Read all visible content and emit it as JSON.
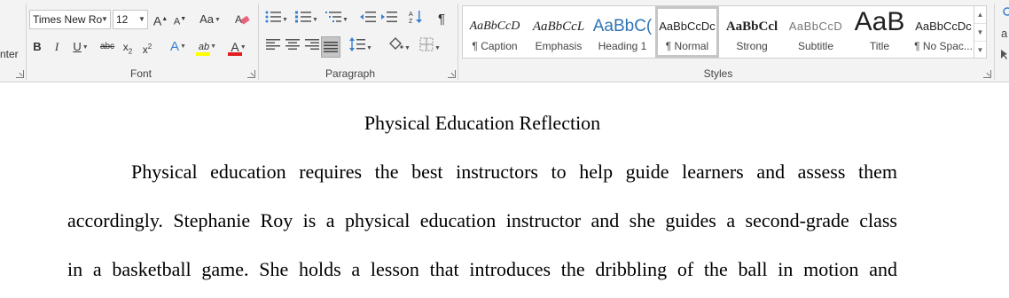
{
  "ribbon": {
    "clipboard": {
      "label_partial": "nter"
    },
    "font": {
      "group_label": "Font",
      "font_name": "Times New Ro",
      "font_size": "12",
      "grow_label": "A",
      "shrink_label": "A",
      "change_case_label": "Aa",
      "bold_label": "B",
      "italic_label": "I",
      "underline_label": "U",
      "strike_label": "abc",
      "subscript_label": "x",
      "subscript_sub": "2",
      "superscript_label": "x",
      "superscript_sup": "2",
      "text_effects_label": "A",
      "highlight_label": "ab",
      "font_color_label": "A",
      "highlight_color": "#ffff00",
      "font_color": "#e01f1f"
    },
    "paragraph": {
      "group_label": "Paragraph",
      "show_marks_label": "¶"
    },
    "styles": {
      "group_label": "Styles",
      "items": [
        {
          "sample": "AaBbCcD",
          "name": "¶ Caption"
        },
        {
          "sample": "AaBbCcL",
          "name": "Emphasis"
        },
        {
          "sample": "AaBbC(",
          "name": "Heading 1"
        },
        {
          "sample": "AaBbCcDc",
          "name": "¶ Normal"
        },
        {
          "sample": "AaBbCcl",
          "name": "Strong"
        },
        {
          "sample": "AaBbCcD",
          "name": "Subtitle"
        },
        {
          "sample": "AaB",
          "name": "Title"
        },
        {
          "sample": "AaBbCcDc",
          "name": "¶ No Spac..."
        }
      ],
      "heading_color": "#2e74b5"
    }
  },
  "document": {
    "title": "Physical Education Reflection",
    "lines": [
      "Physical education requires the best instructors to help guide learners and assess them",
      "accordingly. Stephanie Roy is a physical education instructor and she guides a second-grade class",
      "in a basketball game. She holds a lesson that introduces the dribbling of the ball in motion and"
    ]
  }
}
